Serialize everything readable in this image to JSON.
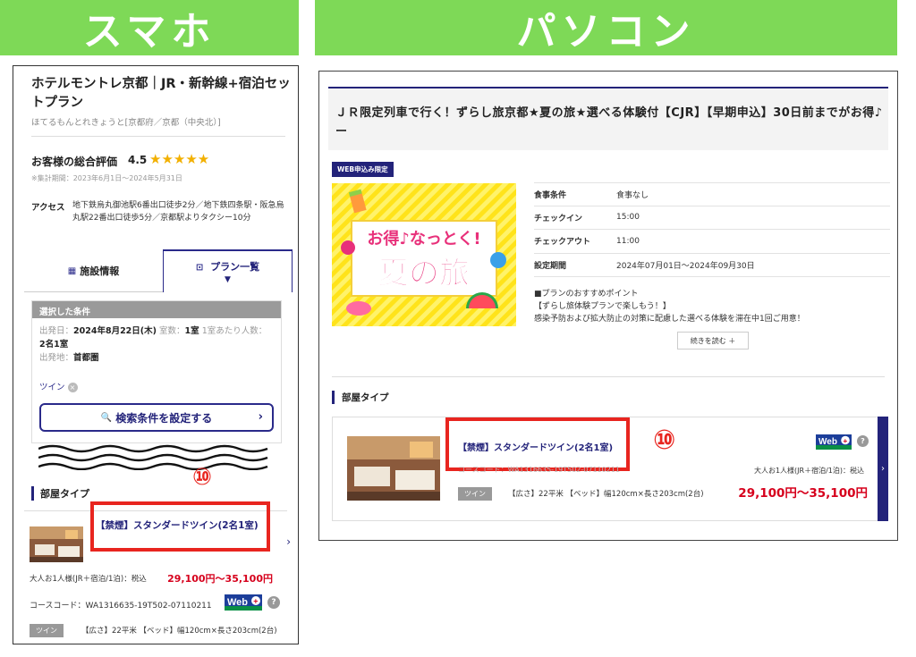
{
  "banners": {
    "smartphone": "スマホ",
    "pc": "パソコン"
  },
  "smartphone": {
    "hotel_name": "ホテルモントレ京都｜JR・新幹線+宿泊セットプラン",
    "hotel_kana": "ほてるもんとれきょうと[京都府／京都（中央北）]",
    "rating_label": "お客様の総合評価",
    "rating_score": "4.5",
    "stars": "★★★★★",
    "rating_period": "※集計期間：2023年6月1日〜2024年5月31日",
    "access_label": "アクセス",
    "access_text": "地下鉄烏丸御池駅6番出口徒歩2分／地下鉄四条駅・阪急烏丸駅22番出口徒歩5分／京都駅よりタクシー10分",
    "tabs": [
      {
        "icon": "▦",
        "label": "施設情報"
      },
      {
        "icon": "⊡",
        "label": "プラン一覧",
        "arrow": "▼"
      }
    ],
    "conditions": {
      "heading": "選択した条件",
      "departure_label": "出発日：",
      "departure_date": "2024年8月22日(木)",
      "rooms_label": "室数：",
      "rooms_value": "1室",
      "per_room_label": "1室あたり人数：",
      "per_room_value": "2名1室",
      "origin_label": "出発地：",
      "origin_value": "首都圏",
      "filter_tag": "ツイン",
      "filter_tag_remove": "×",
      "search_button": "検索条件を設定する",
      "search_icon": "🔍",
      "search_chevron": "›"
    },
    "room_heading": "部屋タイプ",
    "marker": "⑩",
    "room_name": "【禁煙】スタンダードツイン(2名1室)",
    "room_chevron": "›",
    "adult_label": "大人お1人様(JR＋宿泊/1泊)：税込",
    "price": "29,100円〜35,100円",
    "course_code": "コースコード：WA1316635-19T502-07110211",
    "web_badge": "Web",
    "help": "?",
    "room_type": "ツイン",
    "room_spec": "【広さ】22平米 【ベッド】幅120cm×長さ203cm(2台)"
  },
  "pc": {
    "title": "ＪＲ限定列車で行く！ずらし旅京都★夏の旅★選べる体験付【CJR】【早期申込】30日前までがお得♪ー",
    "web_only": "WEB申込み限定",
    "promo": {
      "line1": "お得♪なっとく!",
      "line2": "夏の旅"
    },
    "specs": [
      {
        "k": "食事条件",
        "v": "食事なし"
      },
      {
        "k": "チェックイン",
        "v": "15:00"
      },
      {
        "k": "チェックアウト",
        "v": "11:00"
      },
      {
        "k": "設定期間",
        "v": "2024年07月01日〜2024年09月30日"
      }
    ],
    "point_title": "■プランのおすすめポイント",
    "point_line1": "【ずらし旅体験プランで楽しもう！】",
    "point_line2": "感染予防および拡大防止の対策に配慮した選べる体験を滞在中1回ご用意！",
    "more_button": "続きを読む ＋",
    "room_heading": "部屋タイプ",
    "marker": "⑩",
    "room_name": "【禁煙】スタンダードツイン(2名1室)",
    "ghost_text": "コースコード：WA1316635-19T502-07110211",
    "adult_label": "大人お1人様(JR＋宿泊/1泊)：税込",
    "price": "29,100円〜35,100円",
    "room_type": "ツイン",
    "room_spec": "【広さ】22平米 【ベッド】幅120cm×長さ203cm(2台)",
    "web_badge": "Web",
    "help": "?",
    "side_chevron": "›"
  },
  "colors": {
    "accent": "#23237a",
    "highlight": "#e8251f",
    "banner": "#7ed957",
    "price": "#d6001c",
    "star": "#f2b000"
  }
}
